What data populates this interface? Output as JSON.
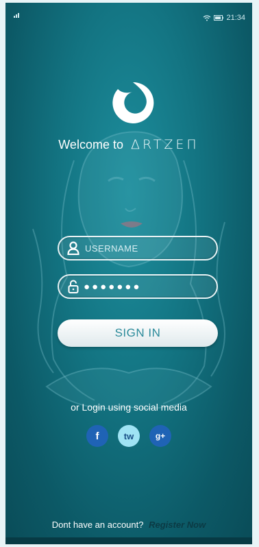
{
  "status_bar": {
    "time": "21:34",
    "signal_icon": "signal-icon",
    "wifi_icon": "wifi-icon",
    "battery_icon": "battery-icon"
  },
  "logo_icon": "artzen-ring-logo",
  "welcome": {
    "text": "Welcome to",
    "brand": "ΔRTZEΠ"
  },
  "form": {
    "username_placeholder": "USERNAME",
    "password_value": "●●●●●●●",
    "username_icon": "user-icon",
    "password_icon": "lock-icon",
    "signin_label": "SIGN IN"
  },
  "social": {
    "prompt": "or Login using social media",
    "buttons": [
      {
        "label": "f",
        "icon": "facebook-icon",
        "color": "#1f63b5"
      },
      {
        "label": "tw",
        "icon": "twitter-icon",
        "color": "#9fe3f4"
      },
      {
        "label": "g+",
        "icon": "google-plus-icon",
        "color": "#1f63b5"
      }
    ]
  },
  "footer": {
    "text": "Dont have an account?",
    "link": "Register Now"
  },
  "colors": {
    "background": "#137482",
    "accent": "#2b8a9a"
  }
}
